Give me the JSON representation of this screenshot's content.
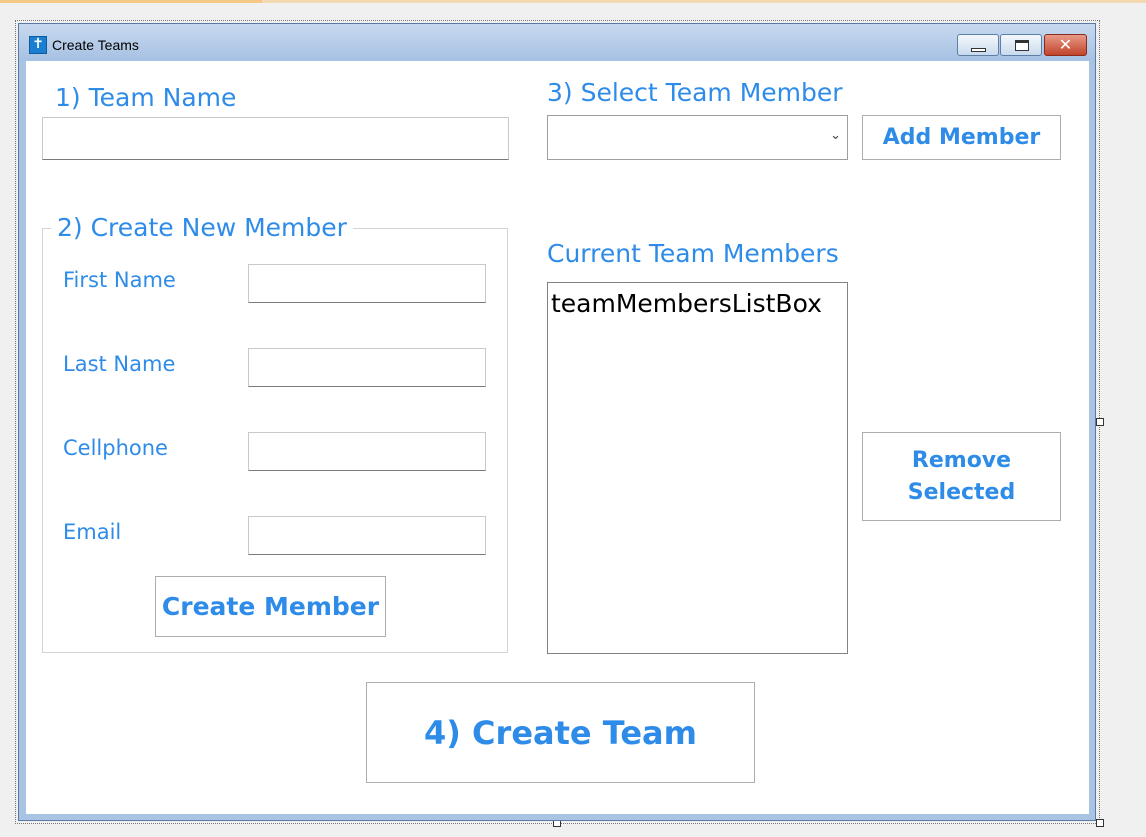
{
  "window": {
    "title": "Create Teams",
    "close_glyph": "✕"
  },
  "labels": {
    "team_name": "1) Team Name",
    "create_new_member": "2) Create New Member",
    "select_team_member": "3) Select Team Member",
    "current_team_members": "Current Team Members",
    "first_name": "First Name",
    "last_name": "Last Name",
    "cellphone": "Cellphone",
    "email": "Email"
  },
  "inputs": {
    "team_name_value": "",
    "first_name_value": "",
    "last_name_value": "",
    "cellphone_value": "",
    "email_value": ""
  },
  "select_team_member": {
    "selected": ""
  },
  "buttons": {
    "add_member": "Add Member",
    "create_member": "Create Member",
    "remove_selected_line1": "Remove",
    "remove_selected_line2": "Selected",
    "create_team": "4) Create Team"
  },
  "team_members_list": {
    "items": [
      "teamMembersListBox"
    ]
  },
  "icons": {
    "app_icon": "app-window-icon",
    "minimize": "minimize-icon",
    "maximize": "maximize-icon",
    "close": "close-icon",
    "dropdown": "chevron-down-icon"
  },
  "colors": {
    "accent_text": "#2e8ce8",
    "titlebar": "#a6c1e3",
    "close_button": "#c2432c"
  }
}
